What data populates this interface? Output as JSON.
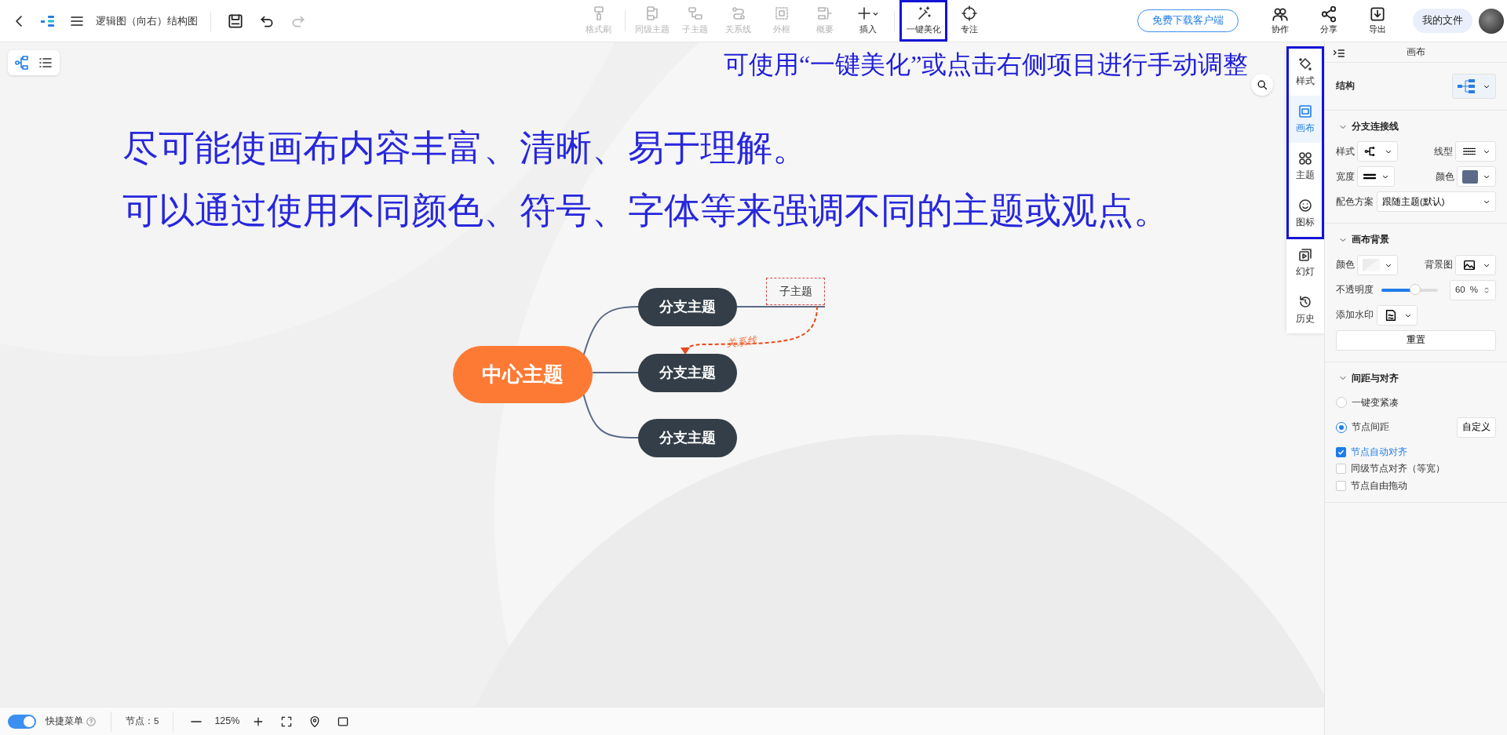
{
  "header": {
    "title": "逻辑图（向右）结构图",
    "tools": [
      {
        "label": "格式刷",
        "disabled": true,
        "menu": false,
        "highlighted": false
      },
      {
        "label": "同级主题",
        "disabled": true,
        "menu": false,
        "highlighted": false
      },
      {
        "label": "子主题",
        "disabled": true,
        "menu": false,
        "highlighted": false
      },
      {
        "label": "关系线",
        "disabled": true,
        "menu": false,
        "highlighted": false
      },
      {
        "label": "外框",
        "disabled": true,
        "menu": false,
        "highlighted": false
      },
      {
        "label": "概要",
        "disabled": true,
        "menu": false,
        "highlighted": false
      },
      {
        "label": "插入",
        "disabled": false,
        "menu": true,
        "highlighted": false
      },
      {
        "label": "一键美化",
        "disabled": false,
        "menu": false,
        "highlighted": true
      },
      {
        "label": "专注",
        "disabled": false,
        "menu": false,
        "highlighted": false
      }
    ],
    "download_button": "免费下载客户端",
    "actions": [
      {
        "label": "协作"
      },
      {
        "label": "分享"
      },
      {
        "label": "导出"
      }
    ],
    "my_files": "我的文件"
  },
  "canvas": {
    "view_modes": [
      {
        "selected": true
      },
      {
        "selected": false
      }
    ],
    "hint": "可使用“一键美化”或点击右侧项目进行手动调整",
    "notes": [
      "尽可能使画布内容丰富、清晰、易于理解。",
      "可以通过使用不同颜色、符号、字体等来强调不同的主题或观点。"
    ],
    "mindmap": {
      "center": "中心主题",
      "branches": [
        "分支主题",
        "分支主题",
        "分支主题"
      ],
      "subtopic": "子主题",
      "relation_label": "关系线"
    }
  },
  "side_tabs": [
    {
      "label": "样式",
      "selected": false,
      "highlighted": true
    },
    {
      "label": "画布",
      "selected": true,
      "highlighted": true
    },
    {
      "label": "主题",
      "selected": false,
      "highlighted": true
    },
    {
      "label": "图标",
      "selected": false,
      "highlighted": true
    },
    {
      "label": "幻灯",
      "selected": false,
      "highlighted": false
    },
    {
      "label": "历史",
      "selected": false,
      "highlighted": false
    }
  ],
  "panel": {
    "title": "画布",
    "structure_label": "结构",
    "sections": [
      {
        "title": "分支连接线",
        "expanded": true,
        "items": [
          {
            "kind": "pair",
            "fields": [
              {
                "label": "样式",
                "kind": "icon"
              },
              {
                "label": "线型",
                "kind": "icon"
              }
            ]
          },
          {
            "kind": "pair",
            "fields": [
              {
                "label": "宽度",
                "kind": "icon"
              },
              {
                "label": "颜色",
                "kind": "color",
                "color": "#5b6a88"
              }
            ]
          },
          {
            "kind": "select",
            "label": "配色方案",
            "value": "跟随主题(默认)"
          }
        ]
      },
      {
        "title": "画布背景",
        "expanded": true,
        "items": [
          {
            "kind": "pair",
            "fields": [
              {
                "label": "颜色",
                "kind": "blank"
              },
              {
                "label": "背景图",
                "kind": "icon"
              }
            ]
          },
          {
            "kind": "slider",
            "label": "不透明度",
            "level": 0.6,
            "value": "60",
            "unit": "%"
          },
          {
            "kind": "dropdown",
            "label": "添加水印"
          },
          {
            "kind": "button",
            "label": "重置"
          }
        ]
      },
      {
        "title": "间距与对齐",
        "expanded": true,
        "items": [
          {
            "kind": "radio",
            "label": "一键变紧凑",
            "selected": false
          },
          {
            "kind": "radio",
            "label": "节点间距",
            "selected": true,
            "button": "自定义"
          },
          {
            "kind": "checkbox",
            "label": "节点自动对齐",
            "checked": true
          },
          {
            "kind": "checkbox",
            "label": "同级节点对齐（等宽）",
            "checked": false
          },
          {
            "kind": "checkbox",
            "label": "节点自由拖动",
            "checked": false
          }
        ]
      }
    ]
  },
  "status_bar": {
    "quick_menu": {
      "label": "快捷菜单",
      "on": true
    },
    "nodes": "节点：5",
    "zoom": "125%"
  }
}
